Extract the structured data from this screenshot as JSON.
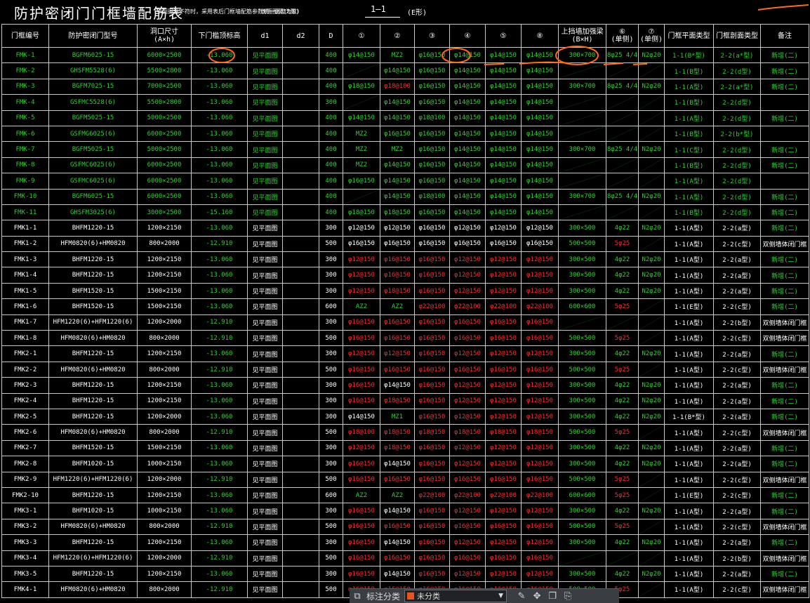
{
  "title": {
    "main": "防护密闭门门框墙配筋表",
    "note": "（平面图注不符时，采用表后门框墙配筋参数统一调整为准）",
    "section": "剖面图见(E形)",
    "mark": "1—1",
    "mark_suffix": "(E形)"
  },
  "headers": [
    "门框编号",
    "防护密闭门型号",
    "洞口尺寸\n(A×h)",
    "下门槛顶标高",
    "d1",
    "d2",
    "D",
    "①",
    "②",
    "③",
    "④",
    "⑤",
    "⑧",
    "上挡墙加强梁\n(B×H)",
    "⑥\n(单侧)",
    "⑦\n(单侧)",
    "门框平面类型",
    "门框剖面类型",
    "备注"
  ],
  "colors": {
    "green": "#2dd22d",
    "red": "#ff2a2a",
    "white": "#ffffff",
    "annotation": "#ff6a13"
  },
  "rows": [
    {
      "id": "FMK-1",
      "model": "BGFM6025-15",
      "size": "6000×2500",
      "elev": "-13.060",
      "d1": "见平面图",
      "D": "400",
      "r": [
        "φ14@150",
        "MZ2",
        "φ16@150",
        "φ14@150",
        "φ14@150",
        "φ14@150"
      ],
      "rc": [
        "g",
        "g",
        "g",
        "g",
        "g",
        "g"
      ],
      "beam": "300×700",
      "r6": "8φ25 4/4",
      "r7": "N2φ20",
      "plan": "1-1(B*型)",
      "sect": "2-2(a*型)",
      "note": "新增(二)",
      "g": true
    },
    {
      "id": "FMK-2",
      "model": "GHSFM5528(6)",
      "size": "5500×2800",
      "elev": "-13.060",
      "d1": "见平面图",
      "D": "400",
      "r": [
        "/",
        "φ14@150",
        "φ16@150",
        "φ14@150",
        "φ14@150",
        "φ14@150"
      ],
      "rc": [
        "g",
        "g",
        "g",
        "g",
        "g",
        "g"
      ],
      "beam": "/",
      "r6": "/",
      "r7": "/",
      "plan": "1-1(B型)",
      "sect": "2-2(d型)",
      "note": "新增(二)",
      "g": true
    },
    {
      "id": "FMK-3",
      "model": "BGFM7025-15",
      "size": "7000×2500",
      "elev": "-13.060",
      "d1": "见平面图",
      "D": "400",
      "r": [
        "φ18@150",
        "φ18@100",
        "φ16@150",
        "φ14@150",
        "φ14@150",
        "φ14@150"
      ],
      "rc": [
        "g",
        "r",
        "g",
        "g",
        "g",
        "g"
      ],
      "beam": "300×700",
      "r6": "8φ25 4/4",
      "r7": "N2φ20",
      "plan": "1-1(A型)",
      "sect": "2-2(a*型)",
      "note": "新增(二)",
      "g": true
    },
    {
      "id": "FMK-4",
      "model": "GSFMC5528(6)",
      "size": "5500×2800",
      "elev": "-13.060",
      "d1": "见平面图",
      "D": "300",
      "r": [
        "/",
        "φ14@150",
        "φ16@150",
        "φ14@150",
        "φ14@150",
        "φ14@150"
      ],
      "rc": [
        "g",
        "g",
        "g",
        "g",
        "g",
        "g"
      ],
      "beam": "/",
      "r6": "/",
      "r7": "/",
      "plan": "1-1(B型)",
      "sect": "2-2(d型)",
      "note": "",
      "g": true
    },
    {
      "id": "FMK-5",
      "model": "BGFM5025-15",
      "size": "5000×2500",
      "elev": "-13.060",
      "d1": "见平面图",
      "D": "400",
      "r": [
        "φ14@150",
        "φ14@150",
        "φ18@100",
        "φ14@150",
        "φ14@150",
        "φ14@150"
      ],
      "rc": [
        "g",
        "g",
        "g",
        "g",
        "g",
        "g"
      ],
      "beam": "/",
      "r6": "/",
      "r7": "/",
      "plan": "1-1(A型)",
      "sect": "2-2(d型)",
      "note": "新增(二)",
      "g": true
    },
    {
      "id": "FMK-6",
      "model": "GSFMG6025(6)",
      "size": "6000×2500",
      "elev": "-13.060",
      "d1": "见平面图",
      "D": "400",
      "r": [
        "MZ2",
        "φ16@150",
        "φ16@150",
        "φ14@150",
        "φ14@150",
        "φ14@150"
      ],
      "rc": [
        "g",
        "g",
        "g",
        "g",
        "g",
        "g"
      ],
      "beam": "/",
      "r6": "/",
      "r7": "/",
      "plan": "1-1(B型)",
      "sect": "2-2(b*型)",
      "note": "",
      "g": true
    },
    {
      "id": "FMK-7",
      "model": "BGFM5025-15",
      "size": "5000×2500",
      "elev": "-13.060",
      "d1": "见平面图",
      "D": "400",
      "r": [
        "MZ2",
        "MZ2",
        "φ16@150",
        "φ14@150",
        "φ14@150",
        "φ14@150"
      ],
      "rc": [
        "g",
        "g",
        "g",
        "g",
        "g",
        "g"
      ],
      "beam": "300×700",
      "r6": "8φ25 4/4",
      "r7": "N2φ20",
      "plan": "1-1(C型)",
      "sect": "2-2(d型)",
      "note": "新增(二)",
      "g": true
    },
    {
      "id": "FMK-8",
      "model": "GSFMC6025(6)",
      "size": "6000×2500",
      "elev": "-13.060",
      "d1": "见平面图",
      "D": "400",
      "r": [
        "MZ2",
        "φ14@150",
        "φ16@150",
        "φ14@150",
        "φ14@150",
        "φ14@150"
      ],
      "rc": [
        "g",
        "g",
        "g",
        "g",
        "g",
        "g"
      ],
      "beam": "/",
      "r6": "/",
      "r7": "/",
      "plan": "1-1(B型)",
      "sect": "2-2(d型)",
      "note": "新增(二)",
      "g": true
    },
    {
      "id": "FMK-9",
      "model": "GSFMC6025(6)",
      "size": "6000×2500",
      "elev": "-13.060",
      "d1": "见平面图",
      "D": "400",
      "r": [
        "φ16@150",
        "φ14@150",
        "φ16@150",
        "φ14@150",
        "φ14@150",
        "φ14@150"
      ],
      "rc": [
        "g",
        "g",
        "g",
        "g",
        "g",
        "g"
      ],
      "beam": "/",
      "r6": "/",
      "r7": "/",
      "plan": "1-1(A型)",
      "sect": "2-2(d型)",
      "note": "",
      "g": true
    },
    {
      "id": "FMK-10",
      "model": "BGFM6025-15",
      "size": "6000×2500",
      "elev": "-13.060",
      "d1": "见平面图",
      "D": "400",
      "r": [
        "/",
        "φ14@150",
        "φ18@100",
        "φ14@150",
        "φ14@150",
        "φ14@150"
      ],
      "rc": [
        "g",
        "g",
        "g",
        "g",
        "g",
        "g"
      ],
      "beam": "300×700",
      "r6": "8φ25 4/4",
      "r7": "N2φ20",
      "plan": "1-1(A型)",
      "sect": "2-2(d型)",
      "note": "新增(二)",
      "g": true
    },
    {
      "id": "FMK-11",
      "model": "GHSFM3025(6)",
      "size": "3000×2500",
      "elev": "-15.160",
      "d1": "见平面图",
      "D": "400",
      "r": [
        "φ18@150",
        "φ18@150",
        "φ16@150",
        "φ14@150",
        "φ14@150",
        "φ14@150"
      ],
      "rc": [
        "g",
        "g",
        "g",
        "g",
        "g",
        "g"
      ],
      "beam": "/",
      "r6": "/",
      "r7": "/",
      "plan": "1-1(B型)",
      "sect": "2-2(d型)",
      "note": "新增(二)",
      "g": true
    },
    {
      "id": "FMK1-1",
      "model": "BHFM1220-15",
      "size": "1200×2150",
      "elev": "-13.060",
      "d1": "见平面图",
      "D": "300",
      "r": [
        "φ12@150",
        "φ12@150",
        "φ16@150",
        "φ12@150",
        "φ12@150",
        "φ12@150"
      ],
      "rc": [
        "w",
        "w",
        "w",
        "w",
        "w",
        "w"
      ],
      "beam": "300×500",
      "r6": "4φ22",
      "r7": "N2φ20",
      "plan": "1-1(A型)",
      "sect": "2-2(a型)",
      "note": "新增(二)",
      "g": false
    },
    {
      "id": "FMK1-2",
      "model": "HFM0820(6)+HM0820",
      "size": "800×2000",
      "elev": "-12.910",
      "d1": "见平面图",
      "D": "500",
      "r": [
        "φ16@150",
        "φ16@150",
        "φ16@150",
        "φ16@150",
        "φ16@150",
        "φ16@150"
      ],
      "rc": [
        "w",
        "w",
        "w",
        "w",
        "w",
        "w"
      ],
      "beam": "500×500",
      "r6": "5φ25",
      "r7": "/",
      "plan": "1-1(A型)",
      "sect": "2-2(c型)",
      "note": "双侧墙体闭门框",
      "g": false
    },
    {
      "id": "FMK1-3",
      "model": "BHFM1220-15",
      "size": "1200×2150",
      "elev": "-13.060",
      "d1": "见平面图",
      "D": "300",
      "r": [
        "φ12@150",
        "φ16@150",
        "φ16@150",
        "φ12@150",
        "φ12@150",
        "φ12@150"
      ],
      "rc": [
        "r",
        "r",
        "r",
        "r",
        "r",
        "r"
      ],
      "beam": "300×500",
      "r6": "4φ22",
      "r7": "N2φ20",
      "plan": "1-1(A型)",
      "sect": "2-2(a型)",
      "note": "新增(二)",
      "g": false
    },
    {
      "id": "FMK1-4",
      "model": "BHFM1220-15",
      "size": "1200×2150",
      "elev": "-13.060",
      "d1": "见平面图",
      "D": "300",
      "r": [
        "φ12@150",
        "φ16@150",
        "φ16@150",
        "φ12@150",
        "φ12@150",
        "φ12@150"
      ],
      "rc": [
        "r",
        "r",
        "r",
        "r",
        "r",
        "r"
      ],
      "beam": "300×500",
      "r6": "4φ22",
      "r7": "N2φ20",
      "plan": "1-1(A型)",
      "sect": "2-2(a型)",
      "note": "新增(二)",
      "g": false
    },
    {
      "id": "FMK1-5",
      "model": "BHFM1520-15",
      "size": "1500×2150",
      "elev": "-13.060",
      "d1": "见平面图",
      "D": "300",
      "r": [
        "φ12@150",
        "φ18@150",
        "φ16@150",
        "φ12@150",
        "φ12@150",
        "φ12@150"
      ],
      "rc": [
        "r",
        "r",
        "r",
        "r",
        "r",
        "r"
      ],
      "beam": "300×500",
      "r6": "4φ22",
      "r7": "N2φ20",
      "plan": "1-1(A型)",
      "sect": "2-2(a型)",
      "note": "新增(二)",
      "g": false
    },
    {
      "id": "FMK1-6",
      "model": "BHFM1520-15",
      "size": "1500×2150",
      "elev": "-13.060",
      "d1": "见平面图",
      "D": "600",
      "r": [
        "AZ2",
        "AZ2",
        "φ22@100",
        "φ22@100",
        "φ22@100",
        "φ22@100"
      ],
      "rc": [
        "g",
        "g",
        "r",
        "r",
        "r",
        "r"
      ],
      "beam": "600×600",
      "r6": "5φ25",
      "r7": "/",
      "plan": "1-1(E型)",
      "sect": "2-2(c型)",
      "note": "新增(二)",
      "g": false
    },
    {
      "id": "FMK1-7",
      "model": "HFM1220(6)+HFM1220(6)",
      "size": "1200×2000",
      "elev": "-12.910",
      "d1": "见平面图",
      "D": "300",
      "r": [
        "φ16@150",
        "φ16@150",
        "φ16@150",
        "φ16@150",
        "φ16@150",
        "φ16@150"
      ],
      "rc": [
        "r",
        "r",
        "r",
        "r",
        "r",
        "r"
      ],
      "beam": "/",
      "r6": "/",
      "r7": "/",
      "plan": "1-1(A型)",
      "sect": "2-2(b型)",
      "note": "双侧墙体闭门框",
      "g": false
    },
    {
      "id": "FMK1-8",
      "model": "HFM0820(6)+HM0820",
      "size": "800×2000",
      "elev": "-12.910",
      "d1": "见平面图",
      "D": "500",
      "r": [
        "φ16@150",
        "φ16@150",
        "φ16@150",
        "φ16@150",
        "φ16@150",
        "φ16@150"
      ],
      "rc": [
        "r",
        "r",
        "r",
        "r",
        "r",
        "r"
      ],
      "beam": "500×500",
      "r6": "5φ25",
      "r7": "/",
      "plan": "1-1(A型)",
      "sect": "2-2(c型)",
      "note": "双侧墙体闭门框",
      "g": false
    },
    {
      "id": "FMK2-1",
      "model": "BHFM1220-15",
      "size": "1200×2150",
      "elev": "-13.060",
      "d1": "见平面图",
      "D": "300",
      "r": [
        "φ12@150",
        "φ12@150",
        "φ16@150",
        "φ12@150",
        "φ12@150",
        "φ12@150"
      ],
      "rc": [
        "r",
        "r",
        "r",
        "r",
        "r",
        "r"
      ],
      "beam": "300×500",
      "r6": "4φ22",
      "r7": "N2φ20",
      "plan": "1-1(A型)",
      "sect": "2-2(a型)",
      "note": "新增(二)",
      "g": false
    },
    {
      "id": "FMK2-2",
      "model": "HFM0820(6)+HM0820",
      "size": "800×2000",
      "elev": "-12.910",
      "d1": "见平面图",
      "D": "500",
      "r": [
        "φ16@150",
        "φ16@150",
        "φ16@150",
        "φ16@150",
        "φ16@150",
        "φ16@150"
      ],
      "rc": [
        "r",
        "r",
        "r",
        "r",
        "r",
        "r"
      ],
      "beam": "500×500",
      "r6": "5φ25",
      "r7": "/",
      "plan": "1-1(A型)",
      "sect": "2-2(c型)",
      "note": "双侧墙体闭门框",
      "g": false
    },
    {
      "id": "FMK2-3",
      "model": "BHFM1220-15",
      "size": "1200×2150",
      "elev": "-13.060",
      "d1": "见平面图",
      "D": "300",
      "r": [
        "φ16@150",
        "φ14@150",
        "φ16@150",
        "φ12@150",
        "φ12@150",
        "φ12@150"
      ],
      "rc": [
        "r",
        "w",
        "r",
        "r",
        "r",
        "r"
      ],
      "beam": "300×500",
      "r6": "4φ22",
      "r7": "N2φ20",
      "plan": "1-1(A型)",
      "sect": "2-2(a型)",
      "note": "新增(二)",
      "g": false
    },
    {
      "id": "FMK2-4",
      "model": "BHFM1220-15",
      "size": "1200×2150",
      "elev": "-13.060",
      "d1": "见平面图",
      "D": "300",
      "r": [
        "φ16@150",
        "φ18@150",
        "φ16@150",
        "φ12@150",
        "φ12@150",
        "φ12@150"
      ],
      "rc": [
        "r",
        "r",
        "r",
        "r",
        "r",
        "r"
      ],
      "beam": "300×500",
      "r6": "4φ22",
      "r7": "N2φ20",
      "plan": "1-1(A型)",
      "sect": "2-2(a型)",
      "note": "新增(二)",
      "g": false
    },
    {
      "id": "FMK2-5",
      "model": "BHFM1220-15",
      "size": "1200×2000",
      "elev": "-13.060",
      "d1": "见平面图",
      "D": "300",
      "r": [
        "φ14@150",
        "MZ1",
        "φ16@150",
        "φ12@150",
        "φ12@150",
        "φ12@150"
      ],
      "rc": [
        "w",
        "g",
        "r",
        "r",
        "r",
        "r"
      ],
      "beam": "300×500",
      "r6": "4φ22",
      "r7": "N2φ20",
      "plan": "1-1(B*型)",
      "sect": "2-2(a型)",
      "note": "新增(二)",
      "g": false
    },
    {
      "id": "FMK2-6",
      "model": "HFM0820(6)+HM0820",
      "size": "800×2000",
      "elev": "-12.910",
      "d1": "见平面图",
      "D": "500",
      "r": [
        "φ18@100",
        "φ18@150",
        "φ18@150",
        "φ18@150",
        "φ18@150",
        "φ18@150"
      ],
      "rc": [
        "r",
        "r",
        "r",
        "r",
        "r",
        "r"
      ],
      "beam": "500×500",
      "r6": "5φ25",
      "r7": "/",
      "plan": "1-1(A型)",
      "sect": "2-2(c型)",
      "note": "双侧墙体闭门框",
      "g": false
    },
    {
      "id": "FMK2-7",
      "model": "BHFM1520-15",
      "size": "1500×2150",
      "elev": "-13.060",
      "d1": "见平面图",
      "D": "300",
      "r": [
        "φ12@150",
        "φ18@150",
        "φ16@150",
        "φ12@150",
        "φ12@150",
        "φ12@150"
      ],
      "rc": [
        "r",
        "r",
        "r",
        "r",
        "r",
        "r"
      ],
      "beam": "300×500",
      "r6": "4φ22",
      "r7": "N2φ20",
      "plan": "1-1(A型)",
      "sect": "2-2(a型)",
      "note": "新增(二)",
      "g": false
    },
    {
      "id": "FMK2-8",
      "model": "BHFM1020-15",
      "size": "1000×2150",
      "elev": "-13.060",
      "d1": "见平面图",
      "D": "300",
      "r": [
        "φ16@150",
        "φ14@150",
        "φ16@150",
        "φ12@150",
        "φ12@150",
        "φ12@150"
      ],
      "rc": [
        "r",
        "w",
        "r",
        "r",
        "r",
        "r"
      ],
      "beam": "300×500",
      "r6": "4φ22",
      "r7": "N2φ20",
      "plan": "1-1(A型)",
      "sect": "2-2(a型)",
      "note": "新增(二)",
      "g": false
    },
    {
      "id": "FMK2-9",
      "model": "HFM1220(6)+HFM1220(6)",
      "size": "1200×2000",
      "elev": "-12.910",
      "d1": "见平面图",
      "D": "500",
      "r": [
        "φ16@150",
        "φ16@150",
        "φ16@150",
        "φ16@150",
        "φ16@150",
        "φ16@150"
      ],
      "rc": [
        "r",
        "r",
        "r",
        "r",
        "r",
        "r"
      ],
      "beam": "500×500",
      "r6": "5φ25",
      "r7": "/",
      "plan": "1-1(A型)",
      "sect": "2-2(c型)",
      "note": "双侧墙体闭门框",
      "g": false
    },
    {
      "id": "FMK2-10",
      "model": "BHFM1220-15",
      "size": "1200×2150",
      "elev": "-13.060",
      "d1": "见平面图",
      "D": "600",
      "r": [
        "AZ2",
        "AZ2",
        "φ22@100",
        "φ22@100",
        "φ22@100",
        "φ22@100"
      ],
      "rc": [
        "g",
        "g",
        "r",
        "r",
        "r",
        "r"
      ],
      "beam": "600×600",
      "r6": "5φ25",
      "r7": "/",
      "plan": "1-1(E型)",
      "sect": "2-2(c型)",
      "note": "新增(二)",
      "g": false
    },
    {
      "id": "FMK3-1",
      "model": "BHFM1020-15",
      "size": "1000×2150",
      "elev": "-13.060",
      "d1": "见平面图",
      "D": "300",
      "r": [
        "φ16@150",
        "φ14@150",
        "φ16@150",
        "φ12@150",
        "φ12@150",
        "φ12@150"
      ],
      "rc": [
        "r",
        "w",
        "r",
        "r",
        "r",
        "r"
      ],
      "beam": "300×500",
      "r6": "4φ22",
      "r7": "N2φ20",
      "plan": "1-1(A型)",
      "sect": "2-2(a型)",
      "note": "新增(二)",
      "g": false
    },
    {
      "id": "FMK3-2",
      "model": "HFM0820(6)+HM0820",
      "size": "800×2000",
      "elev": "-12.910",
      "d1": "见平面图",
      "D": "500",
      "r": [
        "φ16@150",
        "φ16@150",
        "φ16@150",
        "φ16@150",
        "φ16@150",
        "φ16@150"
      ],
      "rc": [
        "r",
        "r",
        "r",
        "r",
        "r",
        "r"
      ],
      "beam": "500×500",
      "r6": "5φ25",
      "r7": "/",
      "plan": "1-1(A型)",
      "sect": "2-2(c型)",
      "note": "双侧墙体闭门框",
      "g": false
    },
    {
      "id": "FMK3-3",
      "model": "BHFM1220-15",
      "size": "1200×2150",
      "elev": "-13.060",
      "d1": "见平面图",
      "D": "300",
      "r": [
        "φ16@150",
        "φ14@150",
        "φ16@150",
        "φ12@150",
        "φ12@150",
        "φ12@150"
      ],
      "rc": [
        "r",
        "w",
        "r",
        "r",
        "r",
        "r"
      ],
      "beam": "300×500",
      "r6": "4φ22",
      "r7": "N2φ20",
      "plan": "1-1(A型)",
      "sect": "2-2(a型)",
      "note": "新增(二)",
      "g": false
    },
    {
      "id": "FMK3-4",
      "model": "HFM1220(6)+HFM1220(6)",
      "size": "1200×2000",
      "elev": "-12.910",
      "d1": "见平面图",
      "D": "500",
      "r": [
        "φ16@150",
        "φ16@150",
        "φ16@150",
        "φ16@150",
        "φ16@150",
        "φ16@150"
      ],
      "rc": [
        "r",
        "r",
        "r",
        "r",
        "r",
        "r"
      ],
      "beam": "/",
      "r6": "/",
      "r7": "/",
      "plan": "1-1(A型)",
      "sect": "2-2(b型)",
      "note": "双侧墙体闭门框",
      "g": false
    },
    {
      "id": "FMK3-5",
      "model": "BHFM1220-15",
      "size": "1200×2150",
      "elev": "-13.060",
      "d1": "见平面图",
      "D": "300",
      "r": [
        "φ16@150",
        "φ14@150",
        "φ16@150",
        "φ12@150",
        "φ12@150",
        "φ12@150"
      ],
      "rc": [
        "r",
        "w",
        "r",
        "r",
        "r",
        "r"
      ],
      "beam": "300×500",
      "r6": "4φ22",
      "r7": "N2φ20",
      "plan": "1-1(A型)",
      "sect": "2-2(a型)",
      "note": "新增(二)",
      "g": false
    },
    {
      "id": "FMK4-1",
      "model": "HFM0820(6)+HM0820",
      "size": "800×2000",
      "elev": "-12.910",
      "d1": "见平面图",
      "D": "500",
      "r": [
        "φ16@150",
        "φ16@150",
        "φ16@150",
        "φ16@150",
        "φ16@150",
        "φ16@150"
      ],
      "rc": [
        "r",
        "r",
        "r",
        "r",
        "r",
        "r"
      ],
      "beam": "500×500",
      "r6": "5φ25",
      "r7": "/",
      "plan": "1-1(A型)",
      "sect": "2-2(c型)",
      "note": "双侧墙体闭门框",
      "g": false
    }
  ],
  "toolbar": {
    "label": "标注分类",
    "category": "未分类",
    "icons": [
      "layers-icon",
      "pen-icon",
      "move-icon",
      "copy-icon",
      "paste-icon"
    ]
  }
}
